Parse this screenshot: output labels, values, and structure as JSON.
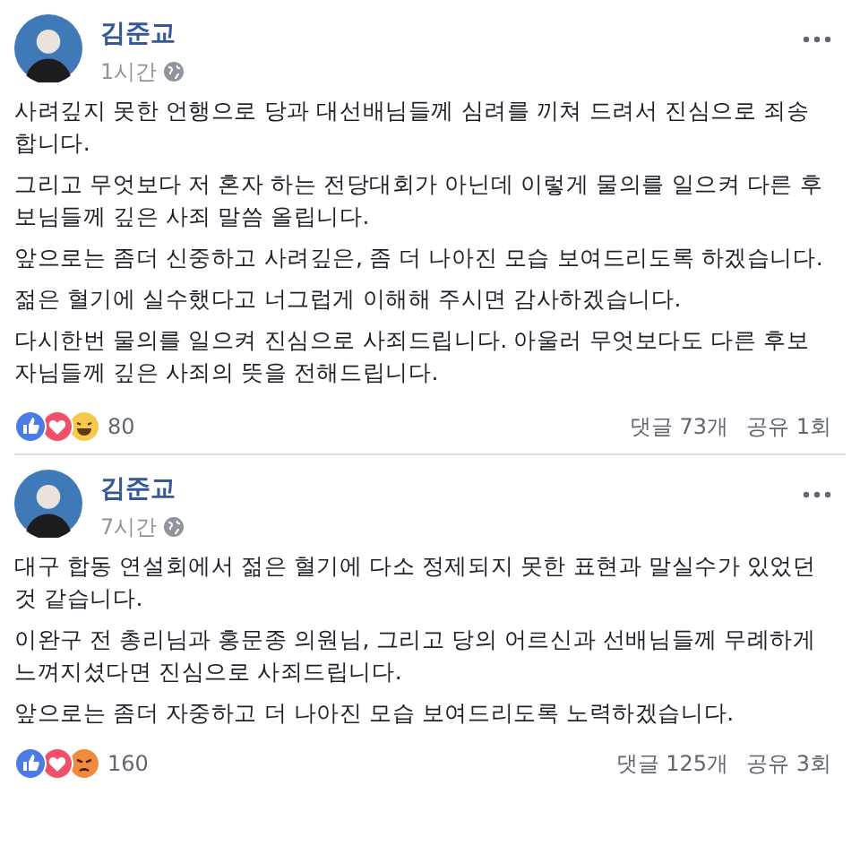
{
  "posts": [
    {
      "author": "김준교",
      "time": "1시간",
      "paragraphs": [
        "사려깊지 못한 언행으로 당과 대선배님들께 심려를 끼쳐 드려서 진심으로 죄송합니다.",
        "그리고 무엇보다 저 혼자 하는 전당대회가 아닌데 이렇게 물의를 일으켜 다른 후보님들께 깊은 사죄 말씀 올립니다.",
        "앞으로는 좀더 신중하고 사려깊은, 좀 더 나아진 모습 보여드리도록 하겠습니다.",
        "젊은 혈기에 실수했다고 너그럽게 이해해 주시면 감사하겠습니다.",
        "다시한번 물의를 일으켜 진심으로 사죄드립니다. 아울러 무엇보다도 다른 후보자님들께 깊은 사죄의 뜻을 전해드립니다."
      ],
      "reactions": [
        {
          "kind": "like"
        },
        {
          "kind": "love"
        },
        {
          "kind": "haha"
        }
      ],
      "reaction_count": "80",
      "comments": "댓글 73개",
      "shares": "공유 1회"
    },
    {
      "author": "김준교",
      "time": "7시간",
      "paragraphs": [
        "대구 합동 연설회에서 젊은 혈기에 다소 정제되지 못한 표현과 말실수가 있었던 것 같습니다.",
        "이완구 전 총리님과 홍문종 의원님, 그리고 당의 어르신과 선배님들께 무례하게 느껴지셨다면 진심으로 사죄드립니다.",
        "앞으로는 좀더 자중하고 더 나아진 모습 보여드리도록 노력하겠습니다."
      ],
      "reactions": [
        {
          "kind": "like"
        },
        {
          "kind": "love"
        },
        {
          "kind": "angry"
        }
      ],
      "reaction_count": "160",
      "comments": "댓글 125개",
      "shares": "공유 3회"
    }
  ]
}
